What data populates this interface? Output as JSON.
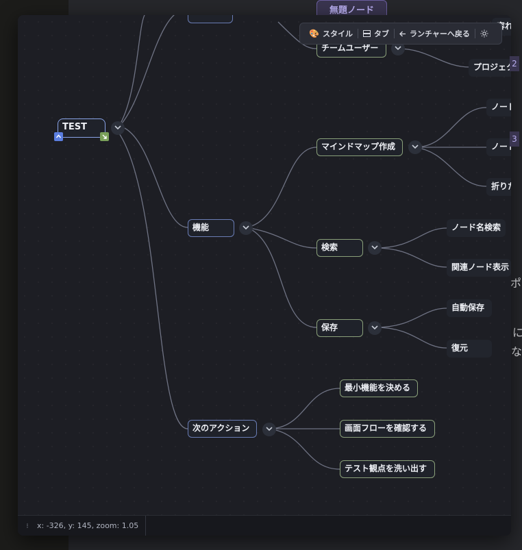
{
  "background": {
    "top_node_label": "無題ノード",
    "right_fragments": [
      "ポ",
      "に",
      "な"
    ],
    "side_numbers": [
      "2",
      "3"
    ]
  },
  "toolbar": {
    "style_label": "スタイル",
    "tab_label": "タブ",
    "launcher_label": "ランチャーへ戻る"
  },
  "nodes": {
    "root": "TEST",
    "team_user": "チームユーザー",
    "project": "プロジェク",
    "partial_top": "容れ",
    "features": "機能",
    "mindmap": "マインドマップ作成",
    "node1": "ノード",
    "node2": "ノード",
    "collapse": "折りた",
    "search": "検索",
    "node_name_search": "ノード名検索",
    "related_nodes": "関連ノード表示",
    "save": "保存",
    "autosave": "自動保存",
    "restore": "復元",
    "next_action": "次のアクション",
    "min_features": "最小機能を決める",
    "screen_flow": "画面フローを確認する",
    "test_points": "テスト観点を洗い出す"
  },
  "status": {
    "coords": "x: -326, y: 145, zoom: 1.05"
  },
  "colors": {
    "node_border_blue": "#6a7db5",
    "node_border_green": "#8aa07a",
    "edge": "#6f7384",
    "badge_blue": "#5b7ee0",
    "badge_green": "#7aa05a"
  }
}
